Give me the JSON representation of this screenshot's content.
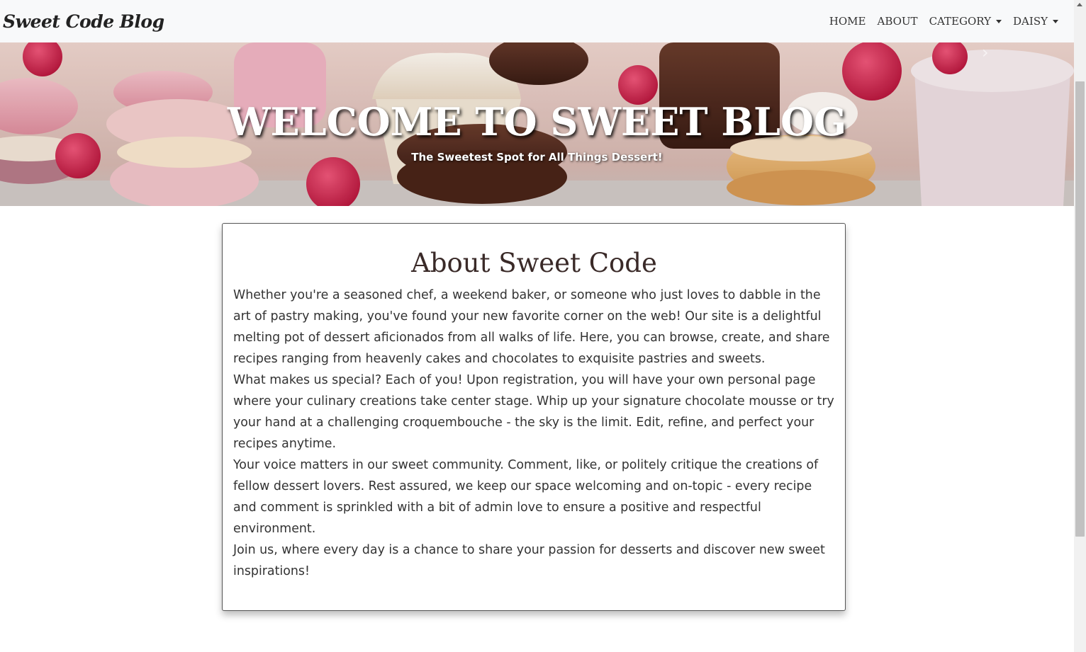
{
  "navbar": {
    "brand": "Sweet Code Blog",
    "links": [
      {
        "label": "HOME",
        "dropdown": false
      },
      {
        "label": "ABOUT",
        "dropdown": false
      },
      {
        "label": "CATEGORY",
        "dropdown": true
      },
      {
        "label": "DAISY",
        "dropdown": true
      }
    ]
  },
  "hero": {
    "title": "WELCOME TO SWEET BLOG",
    "subtitle": "The Sweetest Spot for All Things Dessert!"
  },
  "about": {
    "heading": "About Sweet Code",
    "paragraphs": [
      "Whether you're a seasoned chef, a weekend baker, or someone who just loves to dabble in the art of pastry making, you've found your new favorite corner on the web! Our site is a delightful melting pot of dessert aficionados from all walks of life. Here, you can browse, create, and share recipes ranging from heavenly cakes and chocolates to exquisite pastries and sweets.",
      "What makes us special? Each of you! Upon registration, you will have your own personal page where your culinary creations take center stage. Whip up your signature chocolate mousse or try your hand at a challenging croquembouche - the sky is the limit. Edit, refine, and perfect your recipes anytime.",
      "Your voice matters in our sweet community. Comment, like, or politely critique the creations of fellow dessert lovers. Rest assured, we keep our space welcoming and on-topic - every recipe and comment is sprinkled with a bit of admin love to ensure a positive and respectful environment.",
      "Join us, where every day is a chance to share your passion for desserts and discover new sweet inspirations!"
    ]
  },
  "colors": {
    "navbar_bg": "#f8f9fa",
    "heading_color": "#3a2a28",
    "text_color": "#333333"
  }
}
